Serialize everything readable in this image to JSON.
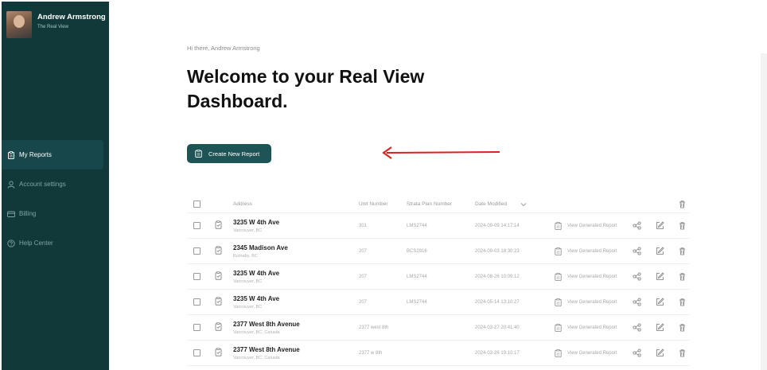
{
  "user": {
    "name": "Andrew Armstrong",
    "org": "The Real View"
  },
  "nav": [
    {
      "label": "My Reports",
      "icon": "clipboard-icon",
      "active": true
    },
    {
      "label": "Account settings",
      "icon": "user-icon",
      "active": false
    },
    {
      "label": "Billing",
      "icon": "card-icon",
      "active": false
    },
    {
      "label": "Help Center",
      "icon": "help-icon",
      "active": false
    }
  ],
  "main": {
    "greeting": "Hi there, Andrew Armstrong",
    "title": "Welcome to your Real View Dashboard.",
    "create_label": "Create New Report"
  },
  "table": {
    "headers": {
      "address": "Address",
      "unit": "Unit Number",
      "strata": "Strata Plan Number",
      "date": "Date Modified"
    },
    "view_label": "View Generated Report",
    "rows": [
      {
        "address": "3235 W 4th Ave",
        "city": "Vancouver, BC",
        "unit": "301",
        "strata": "LMS2744",
        "date": "2024-09-09 14:17:14"
      },
      {
        "address": "2345 Madison Ave",
        "city": "Burnaby, BC",
        "unit": "207",
        "strata": "BCS2916",
        "date": "2024-09-03 18:30:23"
      },
      {
        "address": "3235 W 4th Ave",
        "city": "Vancouver, BC",
        "unit": "207",
        "strata": "LMS2744",
        "date": "2024-08-26 10:09:12"
      },
      {
        "address": "3235 W 4th Ave",
        "city": "Vancouver, BC",
        "unit": "207",
        "strata": "LMS2744",
        "date": "2024-05-14 13:10:27"
      },
      {
        "address": "2377 West 8th Avenue",
        "city": "Vancouver, BC, Canada",
        "unit": "2377 west 8th",
        "strata": "",
        "date": "2024-03-27 20:41:40"
      },
      {
        "address": "2377 West 8th Avenue",
        "city": "Vancouver, BC, Canada",
        "unit": "2377 w 8th",
        "strata": "",
        "date": "2024-03-26 19:10:17"
      }
    ]
  },
  "colors": {
    "sidebar": "#12393a",
    "accent": "#1e5455",
    "annotation_arrow": "#e02020"
  }
}
